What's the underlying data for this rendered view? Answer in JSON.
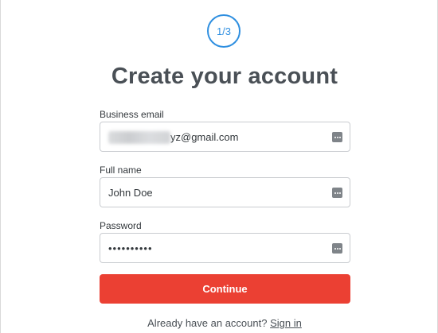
{
  "step": {
    "indicator": "1/3"
  },
  "page": {
    "title": "Create your account"
  },
  "form": {
    "email": {
      "label": "Business email",
      "value": "yz@gmail.com"
    },
    "full_name": {
      "label": "Full name",
      "value": "John Doe"
    },
    "password": {
      "label": "Password",
      "value": "••••••••••"
    },
    "submit_label": "Continue"
  },
  "footer": {
    "prompt": "Already have an account?",
    "link": "Sign in"
  },
  "icons": {
    "autofill": "autofill-key-icon"
  },
  "colors": {
    "accent_blue": "#2f8fe0",
    "primary_button": "#eb4033",
    "title_text": "#4a5056"
  }
}
